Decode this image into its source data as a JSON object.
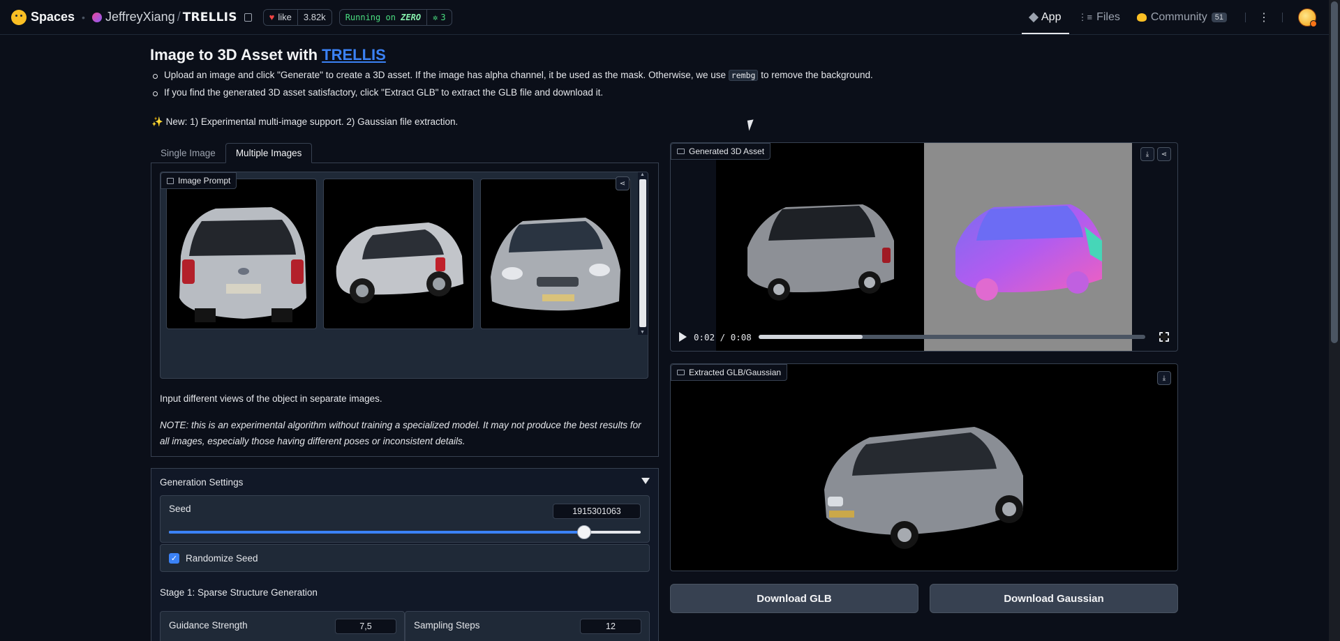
{
  "topbar": {
    "brand": "Spaces",
    "owner": "JeffreyXiang",
    "slash": "/",
    "repo": "TRELLIS",
    "like_label": "like",
    "like_count": "3.82k",
    "running_prefix": "Running on",
    "running_hw": "ZERO",
    "gpu_count": "3",
    "tabs": [
      {
        "label": "App",
        "icon": "cube-icon"
      },
      {
        "label": "Files",
        "icon": "files-icon"
      },
      {
        "label": "Community",
        "icon": "community-icon",
        "badge": "51"
      }
    ]
  },
  "header": {
    "title_prefix": "Image to 3D Asset with",
    "title_link": "TRELLIS",
    "bullet1_a": "Upload an image and click \"Generate\" to create a 3D asset. If the image has alpha channel, it be used as the mask. Otherwise, we use",
    "bullet1_code": "rembg",
    "bullet1_b": "to remove the background.",
    "bullet2": "If you find the generated 3D asset satisfactory, click \"Extract GLB\" to extract the GLB file and download it.",
    "new_line": "New: 1) Experimental multi-image support. 2) Gaussian file extraction."
  },
  "left": {
    "tabs": [
      "Single Image",
      "Multiple Images"
    ],
    "active_tab": "Multiple Images",
    "gallery_label": "Image Prompt",
    "hint": "Input different views of the object in separate images.",
    "note": "NOTE: this is an experimental algorithm without training a specialized model. It may not produce the best results for all images, especially those having different poses or inconsistent details."
  },
  "settings": {
    "title": "Generation Settings",
    "seed_label": "Seed",
    "seed_value": "1915301063",
    "seed_fraction": 0.88,
    "randomize_label": "Randomize Seed",
    "randomize_checked": true,
    "stage1_label": "Stage 1: Sparse Structure Generation",
    "guidance_label": "Guidance Strength",
    "guidance_value": "7,5",
    "steps_label": "Sampling Steps",
    "steps_value": "12"
  },
  "right": {
    "video_label": "Generated 3D Asset",
    "time_current": "0:02",
    "time_total": "0:08",
    "progress_fraction": 0.27,
    "glb_label": "Extracted GLB/Gaussian",
    "download_glb": "Download GLB",
    "download_gaussian": "Download Gaussian"
  },
  "colors": {
    "background": "#0b0f19",
    "accent": "#3b82f6",
    "panel": "#1f2937"
  }
}
